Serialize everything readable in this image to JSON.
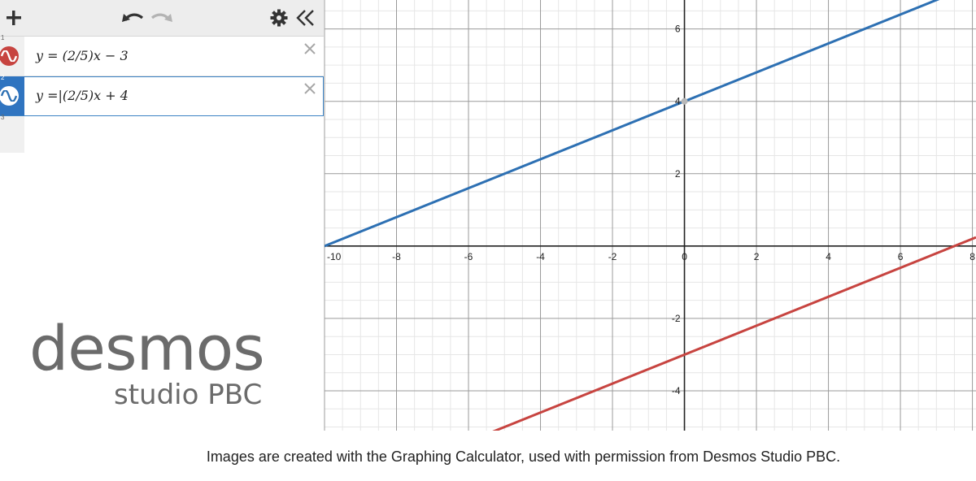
{
  "toolbar": {
    "add_icon": "plus-icon",
    "undo_icon": "undo-icon",
    "redo_icon": "redo-icon",
    "settings_icon": "gear-icon",
    "collapse_icon": "double-chevron-left-icon"
  },
  "expressions": [
    {
      "number": "1",
      "latex": "y = (2/5)x − 3",
      "color": "#c74440",
      "selected": false
    },
    {
      "number": "2",
      "latex": "y =|(2/5)x + 4",
      "color": "#2d70b3",
      "selected": true
    }
  ],
  "empty_row": {
    "number": "3"
  },
  "logo": {
    "main": "desmos",
    "sub": "studio PBC"
  },
  "caption": "Images are created with the Graphing Calculator, used with permission from Desmos Studio PBC.",
  "chart_data": {
    "type": "line",
    "xlim": [
      -10,
      8.1
    ],
    "ylim": [
      -5.1,
      6.8
    ],
    "grid": true,
    "x_ticks": [
      "-10",
      "-8",
      "-6",
      "-4",
      "-2",
      "0",
      "2",
      "4",
      "6",
      "8"
    ],
    "y_ticks": [
      "6",
      "4",
      "2",
      "-2",
      "-4"
    ],
    "series": [
      {
        "color": "#c74440",
        "slope": 0.4,
        "intercept": -3,
        "x": [
          -10,
          8.1
        ],
        "y": [
          -7,
          0.24
        ]
      },
      {
        "color": "#2d70b3",
        "slope": 0.4,
        "intercept": 4,
        "x": [
          -10,
          8.1
        ],
        "y": [
          0,
          7.24
        ]
      }
    ],
    "highlighted_point": {
      "x": 0,
      "y": 4
    }
  }
}
